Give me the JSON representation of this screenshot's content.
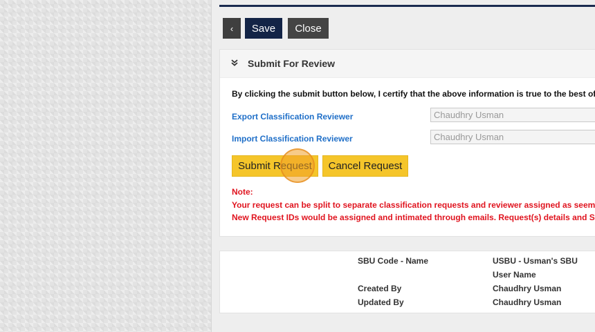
{
  "toolbar": {
    "back_icon": "chevron-left-icon",
    "back_glyph": "‹",
    "save_label": "Save",
    "close_label": "Close"
  },
  "submit_panel": {
    "collapse_icon": "double-chevron-down-icon",
    "collapse_glyph": "»",
    "title": "Submit For Review",
    "certify_text": "By clicking the submit button below, I certify that the above information is true to the best of",
    "export_reviewer": {
      "label": "Export Classification Reviewer",
      "value": "Chaudhry Usman"
    },
    "import_reviewer": {
      "label": "Import Classification Reviewer",
      "value": "Chaudhry Usman"
    },
    "submit_label": "Submit Request",
    "cancel_label": "Cancel Request",
    "note_label": "Note:",
    "note_lines": [
      "Your request can be split to separate classification requests and reviewer assigned as seems",
      "New Request IDs would be assigned and intimated through emails. Request(s) details and St"
    ]
  },
  "info_panel": {
    "sbu_label": "SBU Code - Name",
    "sbu_value": "USBU -  Usman's SBU",
    "user_name_label": "User Name",
    "created_by_label": "Created By",
    "created_by_value": "Chaudhry Usman",
    "updated_by_label": "Updated By",
    "updated_by_value": "Chaudhry Usman"
  },
  "colors": {
    "navy": "#132446",
    "yellow_button": "#f5c52a",
    "link_blue": "#1f6fc8",
    "note_red": "#e0141f"
  }
}
